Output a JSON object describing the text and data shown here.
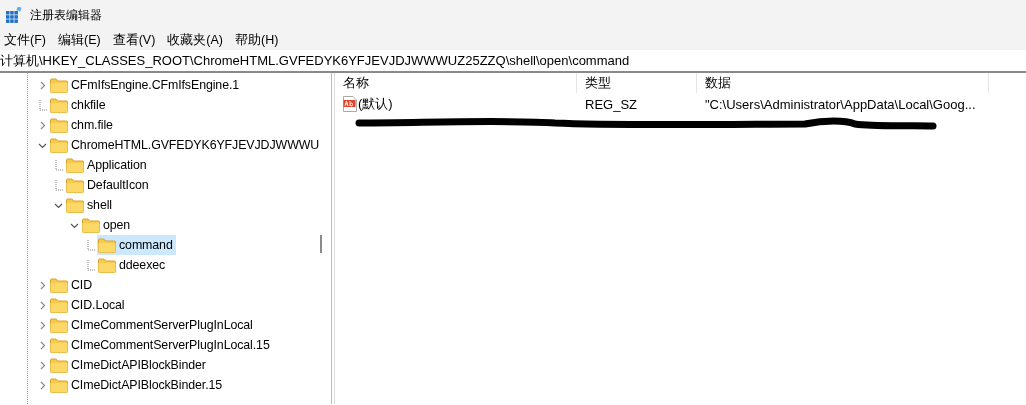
{
  "window": {
    "title": "注册表编辑器"
  },
  "menu": [
    "文件(F)",
    "编辑(E)",
    "查看(V)",
    "收藏夹(A)",
    "帮助(H)"
  ],
  "address": {
    "value": "计算机\\HKEY_CLASSES_ROOT\\ChromeHTML.GVFEDYK6YFJEVJDJWWWUZ25ZZQ\\shell\\open\\command"
  },
  "tree": [
    {
      "label": "CFmIfsEngine.CFmIfsEngine.1",
      "kind": "branch",
      "expanded": false,
      "selected": false
    },
    {
      "label": "chkfile",
      "kind": "leaf",
      "selected": false
    },
    {
      "label": "chm.file",
      "kind": "branch",
      "expanded": false,
      "selected": false
    },
    {
      "label": "ChromeHTML.GVFEDYK6YFJEVJDJWWWU",
      "kind": "branch",
      "expanded": true,
      "selected": false,
      "children": [
        {
          "label": "Application",
          "kind": "leaf",
          "selected": false
        },
        {
          "label": "DefaultIcon",
          "kind": "leaf",
          "selected": false
        },
        {
          "label": "shell",
          "kind": "branch",
          "expanded": true,
          "selected": false,
          "children": [
            {
              "label": "open",
              "kind": "branch",
              "expanded": true,
              "selected": false,
              "children": [
                {
                  "label": "command",
                  "kind": "leaf",
                  "selected": true
                },
                {
                  "label": "ddeexec",
                  "kind": "leaf",
                  "selected": false
                }
              ]
            }
          ]
        }
      ]
    },
    {
      "label": "CID",
      "kind": "branch",
      "expanded": false,
      "selected": false
    },
    {
      "label": "CID.Local",
      "kind": "branch",
      "expanded": false,
      "selected": false
    },
    {
      "label": "CImeCommentServerPlugInLocal",
      "kind": "branch",
      "expanded": false,
      "selected": false
    },
    {
      "label": "CImeCommentServerPlugInLocal.15",
      "kind": "branch",
      "expanded": false,
      "selected": false
    },
    {
      "label": "CImeDictAPIBlockBinder",
      "kind": "branch",
      "expanded": false,
      "selected": false
    },
    {
      "label": "CImeDictAPIBlockBinder.15",
      "kind": "branch",
      "expanded": false,
      "selected": false
    }
  ],
  "values": {
    "columns": [
      "名称",
      "类型",
      "数据"
    ],
    "rows": [
      {
        "name": "(默认)",
        "type": "REG_SZ",
        "data": "\"C:\\Users\\Administrator\\AppData\\Local\\Goog..."
      }
    ]
  }
}
